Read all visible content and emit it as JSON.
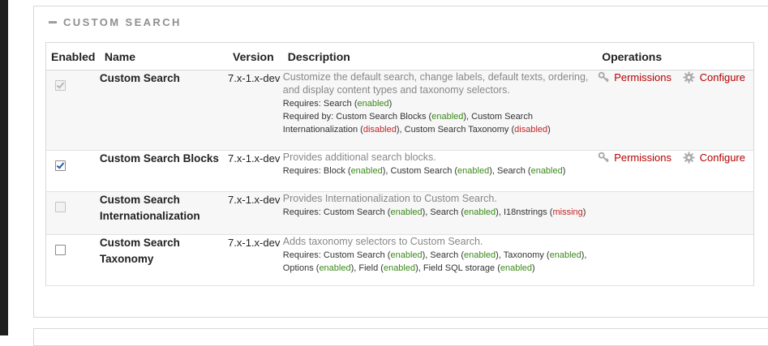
{
  "fieldset": {
    "legend": "CUSTOM SEARCH"
  },
  "table": {
    "headers": {
      "enabled": "Enabled",
      "name": "Name",
      "version": "Version",
      "description": "Description",
      "operations": "Operations"
    },
    "rows": [
      {
        "name": "Custom Search",
        "version": "7.x-1.x-dev",
        "enabled": true,
        "checkbox_disabled": true,
        "description": "Customize the default search, change labels, default texts, ordering, and display content types and taxonomy selectors.",
        "requires_label": "Requires:",
        "requires": [
          {
            "name": "Search",
            "status": "enabled"
          }
        ],
        "required_by_label": "Required by:",
        "required_by": [
          {
            "name": "Custom Search Blocks",
            "status": "enabled"
          },
          {
            "name": "Custom Search Internationalization",
            "status": "disabled"
          },
          {
            "name": "Custom Search Taxonomy",
            "status": "disabled"
          }
        ],
        "ops": {
          "permissions": "Permissions",
          "configure": "Configure"
        }
      },
      {
        "name": "Custom Search Blocks",
        "version": "7.x-1.x-dev",
        "enabled": true,
        "checkbox_disabled": false,
        "description": "Provides additional search blocks.",
        "requires_label": "Requires:",
        "requires": [
          {
            "name": "Block",
            "status": "enabled"
          },
          {
            "name": "Custom Search",
            "status": "enabled"
          },
          {
            "name": "Search",
            "status": "enabled"
          }
        ],
        "ops": {
          "permissions": "Permissions",
          "configure": "Configure"
        }
      },
      {
        "name": "Custom Search Internationalization",
        "version": "7.x-1.x-dev",
        "enabled": false,
        "checkbox_disabled": true,
        "description": "Provides Internationalization to Custom Search.",
        "requires_label": "Requires:",
        "requires": [
          {
            "name": "Custom Search",
            "status": "enabled"
          },
          {
            "name": "Search",
            "status": "enabled"
          },
          {
            "name": "I18nstrings",
            "status": "missing"
          }
        ]
      },
      {
        "name": "Custom Search Taxonomy",
        "version": "7.x-1.x-dev",
        "enabled": false,
        "checkbox_disabled": false,
        "description": "Adds taxonomy selectors to Custom Search.",
        "requires_label": "Requires:",
        "requires": [
          {
            "name": "Custom Search",
            "status": "enabled"
          },
          {
            "name": "Search",
            "status": "enabled"
          },
          {
            "name": "Taxonomy",
            "status": "enabled"
          },
          {
            "name": "Options",
            "status": "enabled"
          },
          {
            "name": "Field",
            "status": "enabled"
          },
          {
            "name": "Field SQL storage",
            "status": "enabled"
          }
        ]
      }
    ]
  },
  "colors": {
    "enabled_status": "#3b8a19",
    "disabled_status": "#c42424",
    "operation_link": "#b40000",
    "legend_text": "#8f8f8f"
  },
  "icons": {
    "collapse": "minus-icon",
    "permissions": "key-icon",
    "configure": "gear-icon"
  }
}
